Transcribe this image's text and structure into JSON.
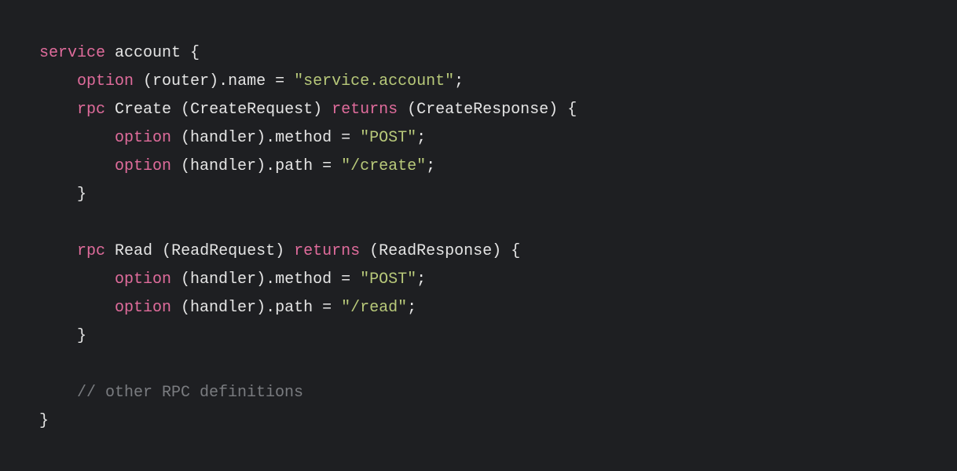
{
  "code": {
    "line1": {
      "keyword": "service",
      "name": "account",
      "brace": " {"
    },
    "line2": {
      "keyword": "option",
      "paren_open": " (",
      "opt_name": "router",
      "paren_close": ")",
      "dot": ".",
      "prop": "name",
      "eq": " = ",
      "value": "\"service.account\"",
      "semi": ";"
    },
    "line3": {
      "keyword": "rpc",
      "name": " Create ",
      "paren_open": "(",
      "req_type": "CreateRequest",
      "paren_close": ") ",
      "returns": "returns",
      "paren_open2": " (",
      "resp_type": "CreateResponse",
      "paren_close2": ") ",
      "brace": "{"
    },
    "line4": {
      "keyword": "option",
      "paren_open": " (",
      "opt_name": "handler",
      "paren_close": ")",
      "dot": ".",
      "prop": "method",
      "eq": " = ",
      "value": "\"POST\"",
      "semi": ";"
    },
    "line5": {
      "keyword": "option",
      "paren_open": " (",
      "opt_name": "handler",
      "paren_close": ")",
      "dot": ".",
      "prop": "path",
      "eq": " = ",
      "value": "\"/create\"",
      "semi": ";"
    },
    "line6": {
      "brace": "}"
    },
    "line8": {
      "keyword": "rpc",
      "name": " Read ",
      "paren_open": "(",
      "req_type": "ReadRequest",
      "paren_close": ") ",
      "returns": "returns",
      "paren_open2": " (",
      "resp_type": "ReadResponse",
      "paren_close2": ") ",
      "brace": "{"
    },
    "line9": {
      "keyword": "option",
      "paren_open": " (",
      "opt_name": "handler",
      "paren_close": ")",
      "dot": ".",
      "prop": "method",
      "eq": " = ",
      "value": "\"POST\"",
      "semi": ";"
    },
    "line10": {
      "keyword": "option",
      "paren_open": " (",
      "opt_name": "handler",
      "paren_close": ")",
      "dot": ".",
      "prop": "path",
      "eq": " = ",
      "value": "\"/read\"",
      "semi": ";"
    },
    "line11": {
      "brace": "}"
    },
    "line13": {
      "comment": "// other RPC definitions"
    },
    "line14": {
      "brace": "}"
    }
  }
}
